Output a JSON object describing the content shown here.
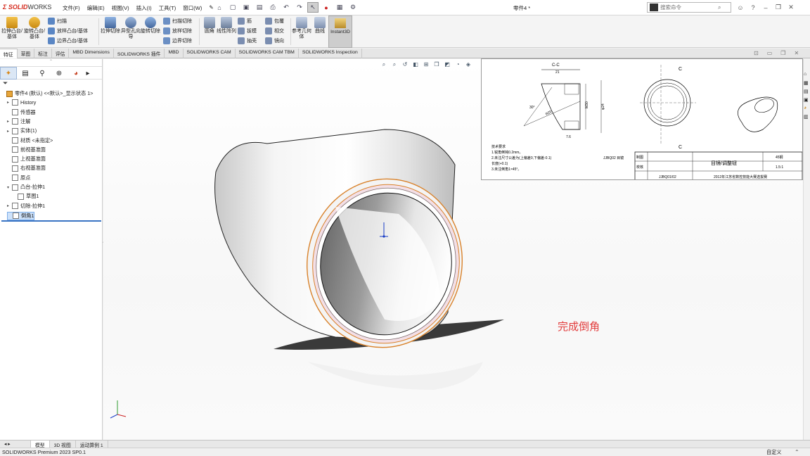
{
  "app": {
    "logo_brand": "SOLID",
    "logo_suffix": "WORKS",
    "document_title": "零件4 *",
    "status": "SOLIDWORKS Premium 2023 SP0.1",
    "status_right": "自定义"
  },
  "menu": [
    "文件(F)",
    "编辑(E)",
    "视图(V)",
    "插入(I)",
    "工具(T)",
    "窗口(W)"
  ],
  "search": {
    "placeholder": "搜索命令"
  },
  "ribbon": {
    "extrude_boss": "拉伸凸台/基体",
    "revolve_boss": "旋转凸台/基体",
    "sweep": "扫描",
    "loft_boss": "放样凸台/基体",
    "boundary_boss": "边界凸台/基体",
    "extrude_cut": "拉伸切除",
    "hole_wizard": "异型孔向导",
    "revolve_cut": "旋转切除",
    "sweep_cut": "扫描切除",
    "loft_cut": "放样切除",
    "boundary_cut": "边界切除",
    "fillet": "圆角",
    "linear_pattern": "线性阵列",
    "rib": "筋",
    "draft": "拔模",
    "shell": "抽壳",
    "wrap": "包覆",
    "intersect": "相交",
    "mirror": "镜向",
    "ref_geometry": "参考几何体",
    "curves": "曲线",
    "instant3d": "Instant3D"
  },
  "tabs": [
    "特征",
    "草图",
    "标注",
    "评估",
    "MBD Dimensions",
    "SOLIDWORKS 插件",
    "MBD",
    "SOLIDWORKS CAM",
    "SOLIDWORKS CAM TBM",
    "SOLIDWORKS Inspection"
  ],
  "tree": [
    {
      "label": "零件4 (默认) <<默认>_显示状态 1>",
      "indent": 0,
      "expand": ""
    },
    {
      "label": "History",
      "indent": 1,
      "expand": "▸"
    },
    {
      "label": "传感器",
      "indent": 1,
      "expand": ""
    },
    {
      "label": "注解",
      "indent": 1,
      "expand": "▸"
    },
    {
      "label": "实体(1)",
      "indent": 1,
      "expand": "▸"
    },
    {
      "label": "材质 <未指定>",
      "indent": 1,
      "expand": ""
    },
    {
      "label": "前视基准面",
      "indent": 1,
      "expand": ""
    },
    {
      "label": "上视基准面",
      "indent": 1,
      "expand": ""
    },
    {
      "label": "右视基准面",
      "indent": 1,
      "expand": ""
    },
    {
      "label": "原点",
      "indent": 1,
      "expand": ""
    },
    {
      "label": "凸台-拉伸1",
      "indent": 1,
      "expand": "▾"
    },
    {
      "label": "草图1",
      "indent": 2,
      "expand": ""
    },
    {
      "label": "切除-拉伸1",
      "indent": 1,
      "expand": "▸"
    },
    {
      "label": "倒角1",
      "indent": 1,
      "expand": "",
      "selected": true
    }
  ],
  "bottom_tabs": [
    "模型",
    "3D 视图",
    "运动算例 1"
  ],
  "annotation": "完成倒角",
  "drawing": {
    "section_label": "C-C",
    "dim_21": "21",
    "dim_r20": "R20",
    "dim_m30": "M30",
    "dim_phi24": "φ24",
    "dim_7_6": "7.6",
    "dim_angle": "30°",
    "view_c_top": "C",
    "view_c_bottom": "C",
    "notes_title": "技术要求",
    "note1": "1.锐角倒钝0.2mm。",
    "note2": "2.未注尺寸公差为(上偏差0,下偏差-0.1)",
    "note3": "  长度(+0.1)",
    "note4": "3.未注倒角1×45°。",
    "tb_code": "JJBQ02 目镜",
    "tb_drawn": "制图",
    "tb_check": "校核",
    "tb_name": "目镜/调整钮",
    "tb_material": "45钢",
    "tb_scale": "1.5:1",
    "tb_no": "JJBQ01/02",
    "tb_comp": "2012年江苏省数控技能大赛选拔赛"
  },
  "colors": {
    "accent": "#d52b1e",
    "selection_edge": "#d9822b",
    "annotation": "#e23b3b"
  }
}
